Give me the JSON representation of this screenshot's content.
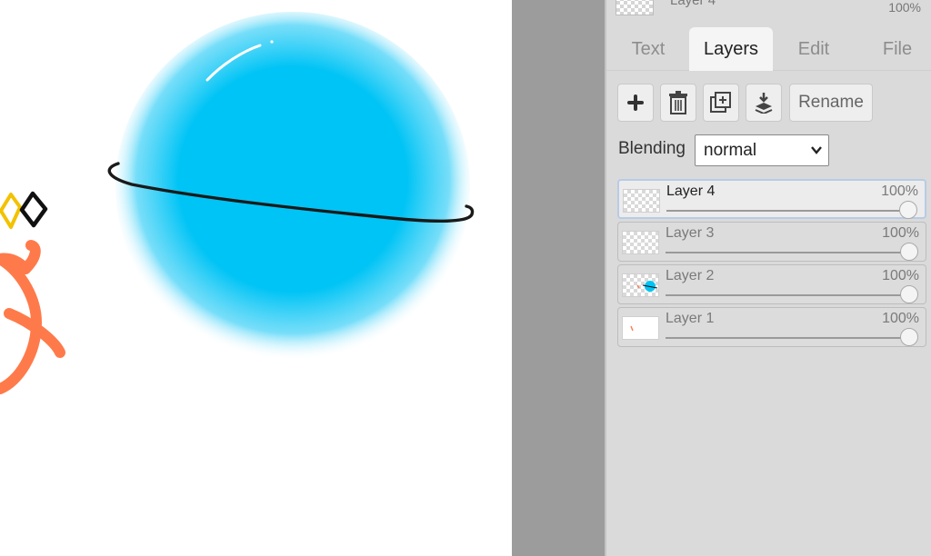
{
  "canvas": {
    "colors": {
      "globe": "#00c4f5",
      "ring": "#1a1a1a",
      "orange": "#ff7a4a",
      "yellow": "#f2c200",
      "background": "#ffffff"
    }
  },
  "panel": {
    "top_layer": {
      "name": "Layer 4",
      "opacity": "100%"
    },
    "tabs": [
      {
        "label": "Text",
        "active": false
      },
      {
        "label": "Layers",
        "active": true
      },
      {
        "label": "Edit",
        "active": false
      },
      {
        "label": "File",
        "active": false
      }
    ],
    "toolbar": {
      "icons": [
        "add-layer-icon",
        "delete-layer-icon",
        "duplicate-layer-icon",
        "merge-down-icon"
      ],
      "rename_label": "Rename"
    },
    "blending": {
      "label": "Blending",
      "value": "normal"
    },
    "layers": [
      {
        "name": "Layer 4",
        "opacity": "100%",
        "selected": true
      },
      {
        "name": "Layer 3",
        "opacity": "100%",
        "selected": false
      },
      {
        "name": "Layer 2",
        "opacity": "100%",
        "selected": false
      },
      {
        "name": "Layer 1",
        "opacity": "100%",
        "selected": false
      }
    ]
  }
}
